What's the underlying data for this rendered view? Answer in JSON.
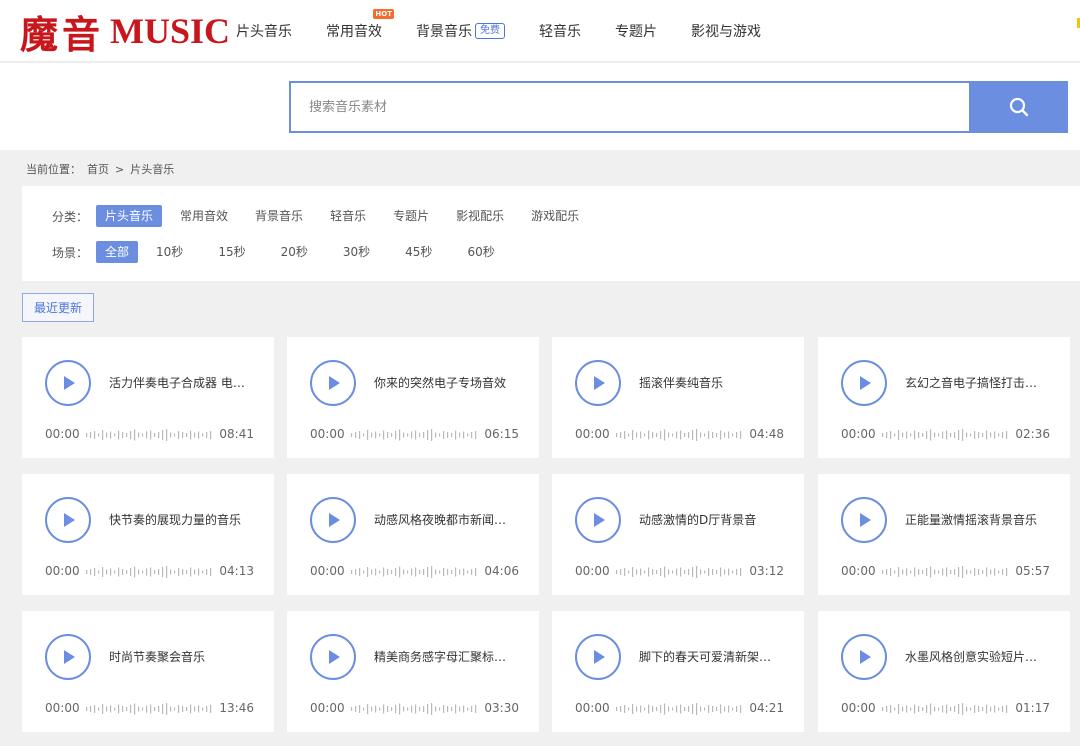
{
  "logo": {
    "cn": "魔音",
    "en": "MUSIC"
  },
  "nav": [
    {
      "label": "片头音乐"
    },
    {
      "label": "常用音效",
      "badge": "HOT"
    },
    {
      "label": "背景音乐",
      "tag": "免费"
    },
    {
      "label": "轻音乐"
    },
    {
      "label": "专题片"
    },
    {
      "label": "影视与游戏"
    }
  ],
  "search": {
    "placeholder": "搜索音乐素材",
    "icon": "search-icon"
  },
  "breadcrumb": {
    "label": "当前位置：",
    "home": "首页",
    "sep": ">",
    "current": "片头音乐"
  },
  "filters": {
    "category_label": "分类：",
    "categories": [
      "片头音乐",
      "常用音效",
      "背景音乐",
      "轻音乐",
      "专题片",
      "影视配乐",
      "游戏配乐"
    ],
    "category_active": 0,
    "scene_label": "场景：",
    "scenes": [
      "全部",
      "10秒",
      "15秒",
      "20秒",
      "30秒",
      "45秒",
      "60秒"
    ],
    "scene_active": 0
  },
  "recent_label": "最近更新",
  "colors": {
    "accent": "#6b8ee0",
    "brand": "#c8161d",
    "hot": "#f56c2d"
  },
  "tracks": [
    {
      "title": "活力伴奏电子合成器 电…",
      "start": "00:00",
      "duration": "08:41"
    },
    {
      "title": "你来的突然电子专场音效",
      "start": "00:00",
      "duration": "06:15"
    },
    {
      "title": "摇滚伴奏纯音乐",
      "start": "00:00",
      "duration": "04:48"
    },
    {
      "title": "玄幻之音电子搞怪打击…",
      "start": "00:00",
      "duration": "02:36"
    },
    {
      "title": "快节奏的展现力量的音乐",
      "start": "00:00",
      "duration": "04:13"
    },
    {
      "title": "动感风格夜晚都市新闻…",
      "start": "00:00",
      "duration": "04:06"
    },
    {
      "title": "动感激情的D厅背景音",
      "start": "00:00",
      "duration": "03:12"
    },
    {
      "title": "正能量激情摇滚背景音乐",
      "start": "00:00",
      "duration": "05:57"
    },
    {
      "title": "时尚节奏聚会音乐",
      "start": "00:00",
      "duration": "13:46"
    },
    {
      "title": "精美商务感字母汇聚标…",
      "start": "00:00",
      "duration": "03:30"
    },
    {
      "title": "脚下的春天可爱清新架…",
      "start": "00:00",
      "duration": "04:21"
    },
    {
      "title": "水墨风格创意实验短片…",
      "start": "00:00",
      "duration": "01:17"
    }
  ]
}
